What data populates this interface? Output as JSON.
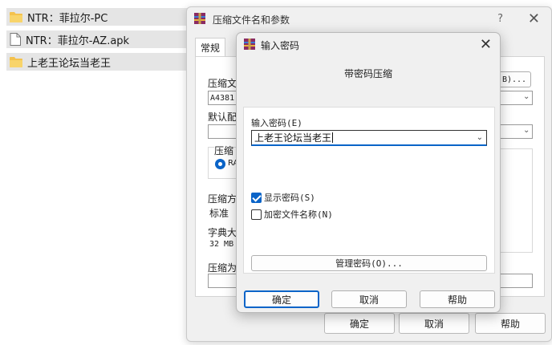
{
  "explorer": {
    "items": [
      {
        "name": "NTR：菲拉尔-PC",
        "icon": "folder-icon"
      },
      {
        "name": "NTR：菲拉尔-AZ.apk",
        "icon": "file-icon"
      },
      {
        "name": "上老王论坛当老王",
        "icon": "folder-icon"
      }
    ]
  },
  "back_dialog": {
    "title": "压缩文件名和参数",
    "help_glyph": "?",
    "close_glyph": "✕",
    "tab_general": "常规",
    "archive_name_label": "压缩文",
    "archive_name_value": "A4381.",
    "browse_button_partial": "B)...",
    "default_profile_label": "默认配",
    "format_group_label": "压缩",
    "format_rar_partial": "RA",
    "method_label": "压缩方",
    "method_value": "标准",
    "dict_label": "字典大",
    "dict_value": "32 MB",
    "split_label": "压缩为",
    "ok": "确定",
    "cancel": "取消",
    "help": "帮助"
  },
  "password_dialog": {
    "title": "输入密码",
    "close_glyph": "✕",
    "heading": "带密码压缩",
    "password_label": "输入密码(E)",
    "password_value": "上老王论坛当老王",
    "show_password_label": "显示密码(S)",
    "show_password_checked": true,
    "encrypt_names_label": "加密文件名称(N)",
    "encrypt_names_checked": false,
    "manage_button": "管理密码(O)...",
    "ok": "确定",
    "cancel": "取消",
    "help": "帮助"
  },
  "colors": {
    "accent": "#0a64c8",
    "folder": "#f4c24d",
    "row_highlight": "#e5e5e5"
  }
}
